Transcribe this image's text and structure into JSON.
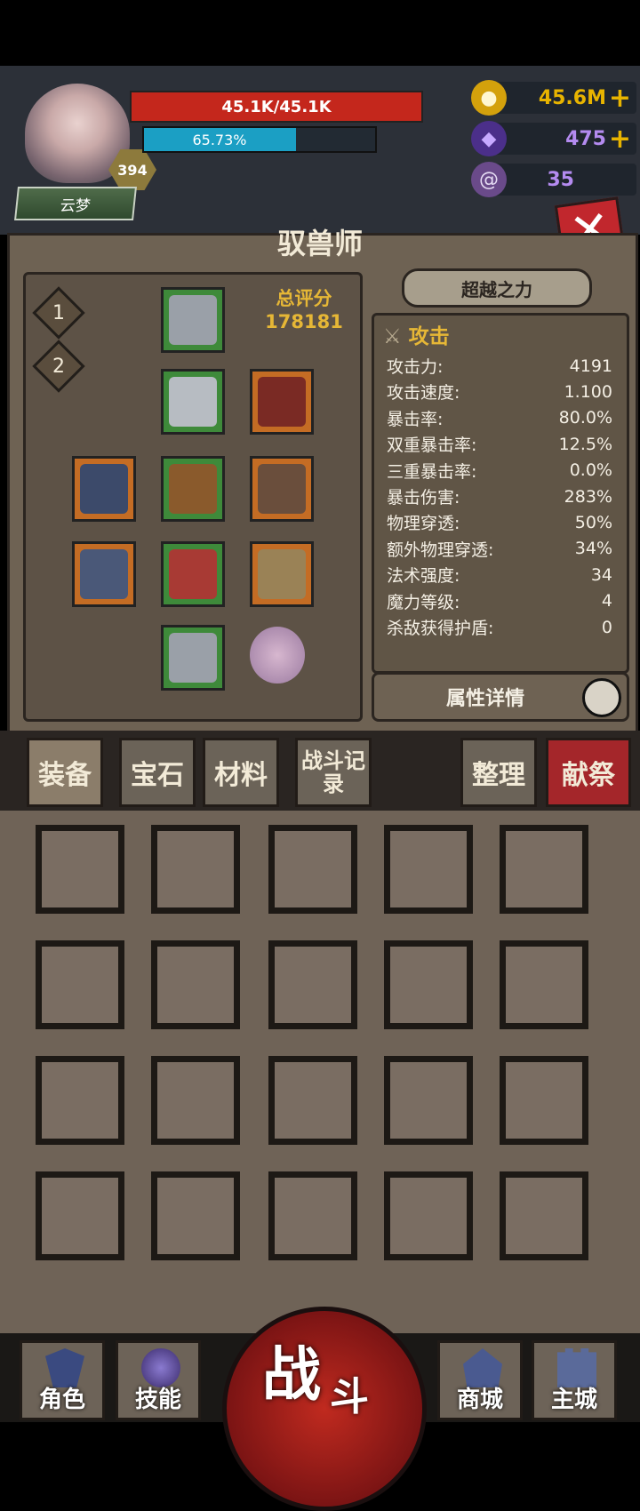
{
  "player": {
    "name": "云梦",
    "level": "394",
    "hp_text": "45.1K/45.1K",
    "xp_text": "65.73%",
    "xp_fraction": 0.6573
  },
  "resources": [
    {
      "name": "gold",
      "value": "45.6M",
      "color": "#e8b400",
      "icon": "coin-icon",
      "has_plus": true
    },
    {
      "name": "gem",
      "value": "475",
      "color": "#b48bf0",
      "icon": "crystal-icon",
      "has_plus": true
    },
    {
      "name": "horn",
      "value": "35",
      "color": "#b48bf0",
      "icon": "ram-horn-icon",
      "has_plus": false
    }
  ],
  "character": {
    "class_title": "驭兽师",
    "score_label": "总评分",
    "score_value": "178181",
    "loadout_tabs": [
      "1",
      "2"
    ]
  },
  "transcend_label": "超越之力",
  "stats": {
    "header": "攻击",
    "rows": [
      {
        "label": "攻击力:",
        "value": "4191"
      },
      {
        "label": "攻击速度:",
        "value": "1.100"
      },
      {
        "label": "暴击率:",
        "value": "80.0%"
      },
      {
        "label": "双重暴击率:",
        "value": "12.5%"
      },
      {
        "label": "三重暴击率:",
        "value": "0.0%"
      },
      {
        "label": "暴击伤害:",
        "value": "283%"
      },
      {
        "label": "物理穿透:",
        "value": "50%"
      },
      {
        "label": "额外物理穿透:",
        "value": "34%"
      },
      {
        "label": "法术强度:",
        "value": "34"
      },
      {
        "label": "魔力等级:",
        "value": "4"
      },
      {
        "label": "杀敌获得护盾:",
        "value": "0"
      }
    ],
    "detail_button": "属性详情"
  },
  "inventory_tabs": [
    {
      "label": "装备",
      "active": true
    },
    {
      "label": "宝石",
      "active": false
    },
    {
      "label": "材料",
      "active": false
    },
    {
      "label": "战斗记录",
      "active": false
    }
  ],
  "inventory_actions": [
    {
      "label": "整理"
    },
    {
      "label": "献祭"
    }
  ],
  "bottom_nav": [
    {
      "label": "角色",
      "icon": "helmet-icon"
    },
    {
      "label": "技能",
      "icon": "swirl-icon"
    },
    {
      "label": "战斗",
      "icon": "fight-icon"
    },
    {
      "label": "商城",
      "icon": "shop-icon"
    },
    {
      "label": "主城",
      "icon": "castle-icon"
    }
  ]
}
